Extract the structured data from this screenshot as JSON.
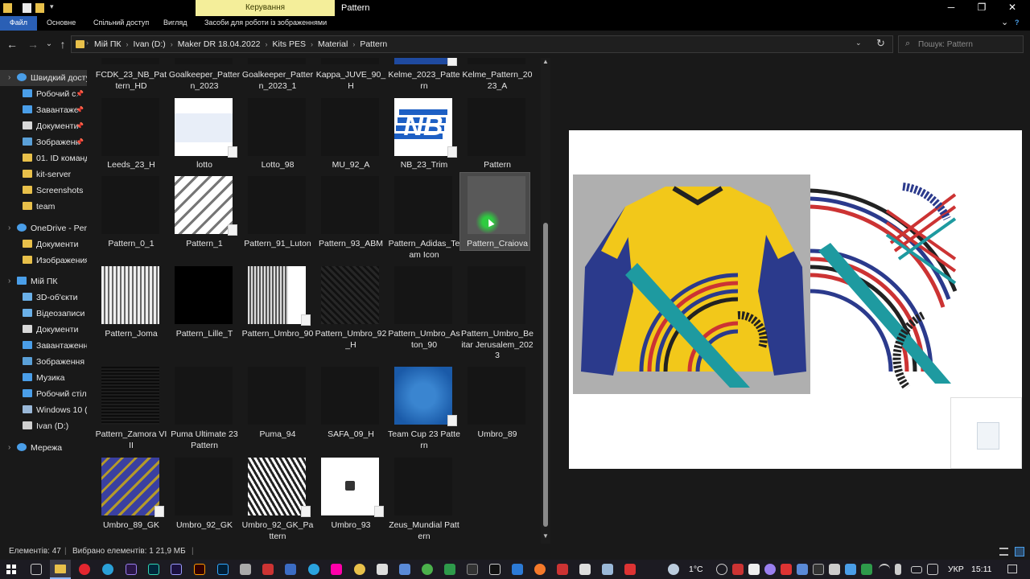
{
  "window": {
    "title": "Pattern",
    "manage_tab": "Керування",
    "min": "─",
    "max": "❐",
    "close": "✕"
  },
  "ribbon": {
    "tabs": [
      "Файл",
      "Основне",
      "Спільний доступ",
      "Вигляд",
      "Засоби для роботи із зображеннями"
    ],
    "expand": "⌄",
    "help": "?"
  },
  "nav": {
    "back": "←",
    "forward": "→",
    "recent": "⌄",
    "up": "↑"
  },
  "address": {
    "crumbs": [
      "Мій ПК",
      "Ivan  (D:)",
      "Maker DR 18.04.2022",
      "Kits PES",
      "Material",
      "Pattern"
    ],
    "separator": "›",
    "refresh": "↻"
  },
  "search": {
    "placeholder": "Пошук: Pattern"
  },
  "sidebar": {
    "items": [
      {
        "label": "Швидкий досту",
        "icon": "star-icon",
        "color": "#4a9ee8",
        "pin": false
      },
      {
        "label": "Робочий с",
        "icon": "desktop-icon",
        "color": "#4a9ee8",
        "pin": true
      },
      {
        "label": "Завантаже",
        "icon": "download-icon",
        "color": "#4a9ee8",
        "pin": true
      },
      {
        "label": "Документи",
        "icon": "documents-icon",
        "color": "#d8d8d8",
        "pin": true
      },
      {
        "label": "Зображенн",
        "icon": "pictures-icon",
        "color": "#5aa0d8",
        "pin": true
      },
      {
        "label": "01. ID команд",
        "icon": "folder-icon",
        "color": "#e8c04a",
        "pin": false
      },
      {
        "label": "kit-server",
        "icon": "folder-icon",
        "color": "#e8c04a",
        "pin": false
      },
      {
        "label": "Screenshots",
        "icon": "folder-icon",
        "color": "#e8c04a",
        "pin": false
      },
      {
        "label": "team",
        "icon": "folder-icon",
        "color": "#e8c04a",
        "pin": false
      },
      {
        "label": "OneDrive - Pers",
        "icon": "cloud-icon",
        "color": "#4a9ee8",
        "pin": false
      },
      {
        "label": "Документи",
        "icon": "folder-icon",
        "color": "#e8c04a",
        "pin": false
      },
      {
        "label": "Изображения",
        "icon": "folder-icon",
        "color": "#e8c04a",
        "pin": false
      },
      {
        "label": "Мій ПК",
        "icon": "computer-icon",
        "color": "#4a9ee8",
        "pin": false
      },
      {
        "label": "3D-об'єкти",
        "icon": "cube-icon",
        "color": "#6ab0e8",
        "pin": false
      },
      {
        "label": "Відеозаписи",
        "icon": "video-icon",
        "color": "#6ab0e8",
        "pin": false
      },
      {
        "label": "Документи",
        "icon": "documents-icon",
        "color": "#d8d8d8",
        "pin": false
      },
      {
        "label": "Завантаження",
        "icon": "download-icon",
        "color": "#4a9ee8",
        "pin": false
      },
      {
        "label": "Зображення",
        "icon": "pictures-icon",
        "color": "#5aa0d8",
        "pin": false
      },
      {
        "label": "Музика",
        "icon": "music-icon",
        "color": "#4a9ee8",
        "pin": false
      },
      {
        "label": "Робочий стіл",
        "icon": "folder-icon",
        "color": "#4a9ee8",
        "pin": false
      },
      {
        "label": "Windows 10 (C",
        "icon": "drive-icon",
        "color": "#9ab8d8",
        "pin": false
      },
      {
        "label": "Ivan  (D:)",
        "icon": "drive-icon",
        "color": "#cfcfcf",
        "pin": false
      },
      {
        "label": "Мережа",
        "icon": "network-icon",
        "color": "#4a9ee8",
        "pin": false
      }
    ],
    "pin_glyph": "📌"
  },
  "files": [
    {
      "name": "FCDK_23_NB_Pattern_HD",
      "thumb": "dark",
      "doc": false
    },
    {
      "name": "Goalkeeper_Pattern_2023",
      "thumb": "dark",
      "doc": false
    },
    {
      "name": "Goalkeeper_Pattern_2023_1",
      "thumb": "dark",
      "doc": false
    },
    {
      "name": "Kappa_JUVE_90_H",
      "thumb": "dark",
      "doc": false
    },
    {
      "name": "Kelme_2023_Pattern",
      "thumb": "blue-top",
      "doc": true
    },
    {
      "name": "Kelme_Pattern_2023_A",
      "thumb": "dark",
      "doc": false
    },
    {
      "name": "Leeds_23_H",
      "thumb": "dark",
      "doc": false
    },
    {
      "name": "lotto",
      "thumb": "lotto",
      "doc": true
    },
    {
      "name": "Lotto_98",
      "thumb": "dark",
      "doc": false
    },
    {
      "name": "MU_92_A",
      "thumb": "dark",
      "doc": false
    },
    {
      "name": "NB_23_Trim",
      "thumb": "nb",
      "doc": true
    },
    {
      "name": "Pattern",
      "thumb": "dark",
      "doc": false
    },
    {
      "name": "Pattern_0_1",
      "thumb": "dark",
      "doc": false
    },
    {
      "name": "Pattern_1",
      "thumb": "zigzag",
      "doc": true
    },
    {
      "name": "Pattern_91_Luton",
      "thumb": "dark",
      "doc": false
    },
    {
      "name": "Pattern_93_ABM",
      "thumb": "dark",
      "doc": false
    },
    {
      "name": "Pattern_Adidas_Team Icon",
      "thumb": "dark",
      "doc": false
    },
    {
      "name": "Pattern_Craiova",
      "thumb": "grey",
      "doc": false,
      "selected": true
    },
    {
      "name": "Pattern_Joma",
      "thumb": "vstripes",
      "doc": false
    },
    {
      "name": "Pattern_Lille_T",
      "thumb": "black",
      "doc": false
    },
    {
      "name": "Pattern_Umbro_90",
      "thumb": "halfstripe",
      "doc": true
    },
    {
      "name": "Pattern_Umbro_92_H",
      "thumb": "darkweave",
      "doc": false
    },
    {
      "name": "Pattern_Umbro_Aston_90",
      "thumb": "dark",
      "doc": false
    },
    {
      "name": "Pattern_Umbro_Beitar Jerusalem_2023",
      "thumb": "dark",
      "doc": false
    },
    {
      "name": "Pattern_Zamora VIII",
      "thumb": "darkstripe",
      "doc": false
    },
    {
      "name": "Puma Ultimate 23 Pattern",
      "thumb": "dark",
      "doc": false
    },
    {
      "name": "Puma_94",
      "thumb": "dark",
      "doc": false
    },
    {
      "name": "SAFA_09_H",
      "thumb": "dark",
      "doc": false
    },
    {
      "name": "Team Cup 23 Pattern",
      "thumb": "blue",
      "doc": true
    },
    {
      "name": "Umbro_89",
      "thumb": "dark",
      "doc": false
    },
    {
      "name": "Umbro_89_GK",
      "thumb": "chevron",
      "doc": true
    },
    {
      "name": "Umbro_92_GK",
      "thumb": "dark",
      "doc": false
    },
    {
      "name": "Umbro_92_GK_Pattern",
      "thumb": "bwpattern",
      "doc": true
    },
    {
      "name": "Umbro_93",
      "thumb": "white",
      "doc": true
    },
    {
      "name": "Zeus_Mundial Pattern",
      "thumb": "dark",
      "doc": false
    }
  ],
  "status": {
    "count": "Елементів: 47",
    "selected": "Вибрано елементів: 1  21,9 МБ"
  },
  "taskbar": {
    "weather": "1°C",
    "lang": "УКР",
    "time": "15:11"
  }
}
